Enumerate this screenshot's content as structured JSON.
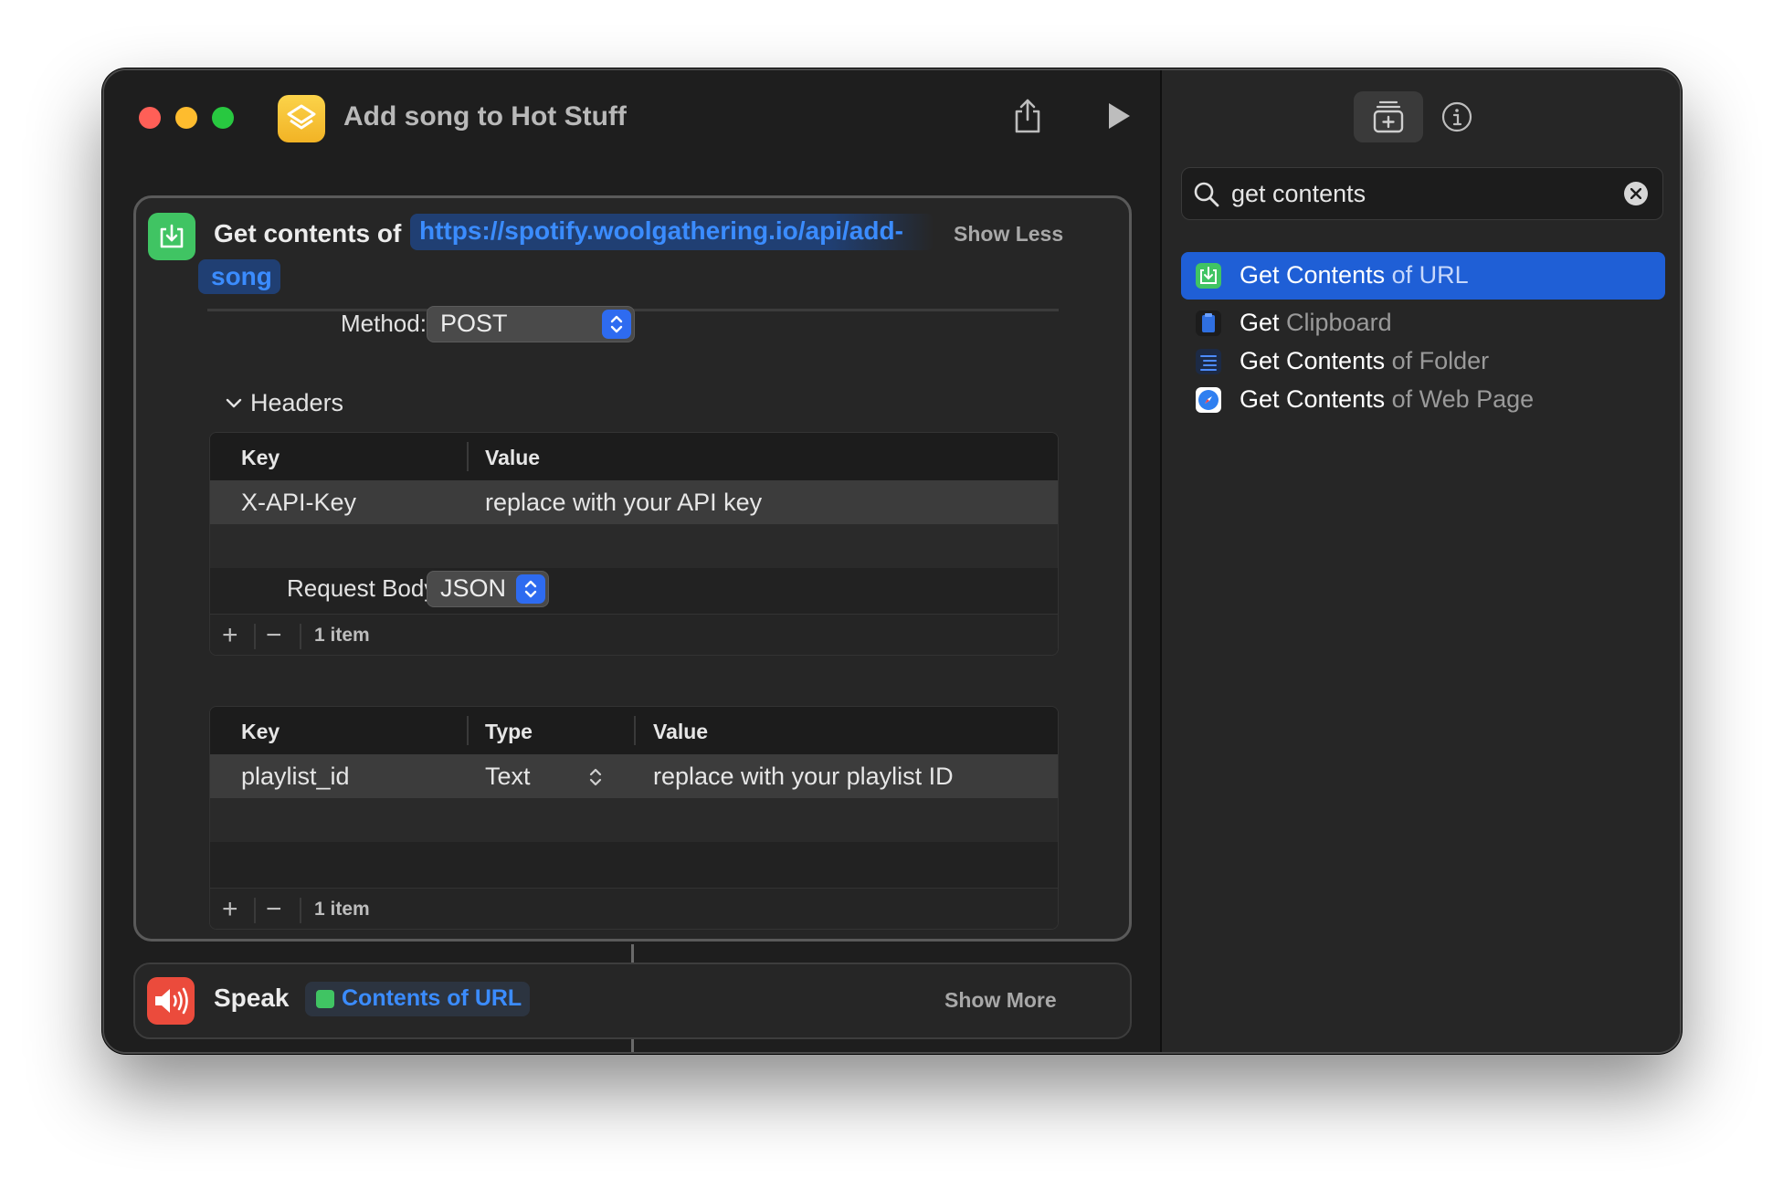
{
  "window": {
    "title": "Add song to Hot Stuff"
  },
  "action_get_contents": {
    "label": "Get contents of",
    "url_part1": "https://spotify.woolgathering.io/api/add-",
    "url_part2": "song",
    "toggle": "Show Less",
    "method_label": "Method:",
    "method_value": "POST",
    "headers_label": "Headers",
    "headers_table": {
      "columns": [
        "Key",
        "Value"
      ],
      "rows": [
        {
          "key": "X-API-Key",
          "value": "replace with your API key"
        }
      ],
      "count": "1 item"
    },
    "request_body_label": "Request Body:",
    "request_body_value": "JSON",
    "body_table": {
      "columns": [
        "Key",
        "Type",
        "Value"
      ],
      "rows": [
        {
          "key": "playlist_id",
          "type": "Text",
          "value": "replace with your playlist ID"
        }
      ],
      "count": "1 item"
    }
  },
  "action_speak": {
    "label": "Speak",
    "variable": "Contents of URL",
    "toggle": "Show More"
  },
  "sidebar": {
    "search_query": "get contents",
    "results": [
      {
        "strong": "Get Contents",
        "dim": " of URL",
        "icon": "download-icon",
        "color": "#40c463",
        "selected": true
      },
      {
        "strong": "Get",
        "dim": " Clipboard",
        "icon": "clipboard-icon",
        "color": "#2f6fe0",
        "selected": false
      },
      {
        "strong": "Get Contents",
        "dim": " of Folder",
        "icon": "list-icon",
        "color": "#2f6fe0",
        "selected": false
      },
      {
        "strong": "Get Contents",
        "dim": " of Web Page",
        "icon": "safari-icon",
        "color": "#ffffff",
        "selected": false
      }
    ]
  },
  "colors": {
    "accent": "#1f5fd6",
    "token_text": "#3b8cff",
    "get_contents_icon": "#40c463",
    "speak_icon": "#eb4b3c",
    "app_icon": "#f2b325"
  }
}
